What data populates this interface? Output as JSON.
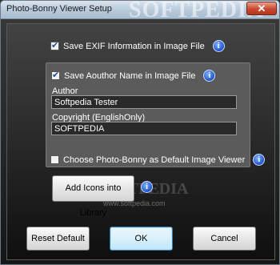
{
  "window": {
    "title": "Photo-Bonny Viewer Setup",
    "title_watermark": "SOFTPEDIA",
    "close_glyph": "✕"
  },
  "options": {
    "save_exif_label": "Save EXIF Information in Image File",
    "save_exif_checked": true,
    "save_author_label": "Save Aouthor Name in Image File",
    "save_author_checked": true,
    "default_viewer_label": "Choose Photo-Bonny as Default Image Viewer",
    "default_viewer_checked": false
  },
  "author": {
    "label": "Author",
    "value": "Softpedia Tester"
  },
  "copyright": {
    "label": "Copyright (EnglishOnly)",
    "value": "SOFTPEDIA"
  },
  "info_glyph": "i",
  "buttons": {
    "add_icons": "Add Icons into Library",
    "reset": "Reset Default",
    "ok": "OK",
    "cancel": "Cancel"
  },
  "watermark": {
    "text": "SOFTPEDIA",
    "url": "www.softpedia.com"
  },
  "colors": {
    "info_icon": "#1f55c9",
    "titlebar": "#b7c8da",
    "close_button": "#c8492f"
  }
}
